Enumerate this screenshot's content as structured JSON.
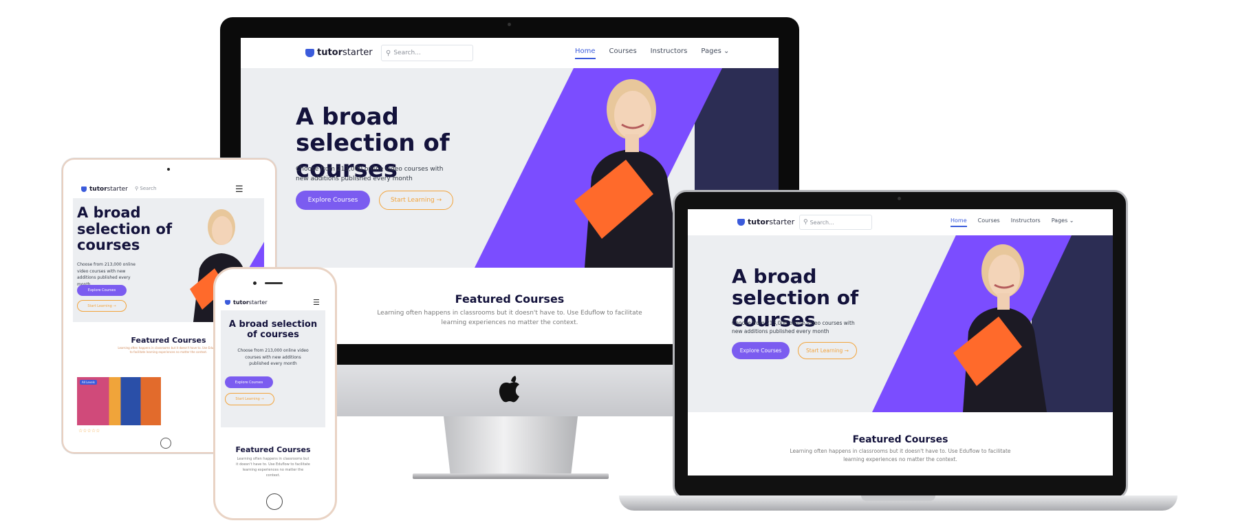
{
  "brand": {
    "name_bold": "tutor",
    "name_light": " starter"
  },
  "search": {
    "placeholder": "Search..."
  },
  "search_tablet": {
    "placeholder": "Search"
  },
  "nav": {
    "items": [
      "Home",
      "Courses",
      "Instructors",
      "Pages ⌄"
    ]
  },
  "hero": {
    "title": "A broad selection of courses",
    "description": "Choose from 213,000 online video courses with new additions published every month",
    "primary_button": "Explore Courses",
    "secondary_button": "Start Learning →"
  },
  "featured": {
    "title": "Featured Courses",
    "description": "Learning often happens in classrooms but it doesn't have to. Use Eduflow to facilitate learning experiences no matter the context."
  },
  "tablet": {
    "card_badge": "All Levels",
    "rating": "☆☆☆☆☆"
  },
  "colors": {
    "accent": "#7b5cf0",
    "orange": "#f2a33a",
    "purple_band": "#7b4dff",
    "navy_band": "#2c2d54",
    "heading": "#13123b"
  },
  "icons": {
    "logo": "owl-logo-icon",
    "search": "search-icon",
    "menu": "hamburger-menu-icon",
    "apple": "apple-logo-icon"
  }
}
